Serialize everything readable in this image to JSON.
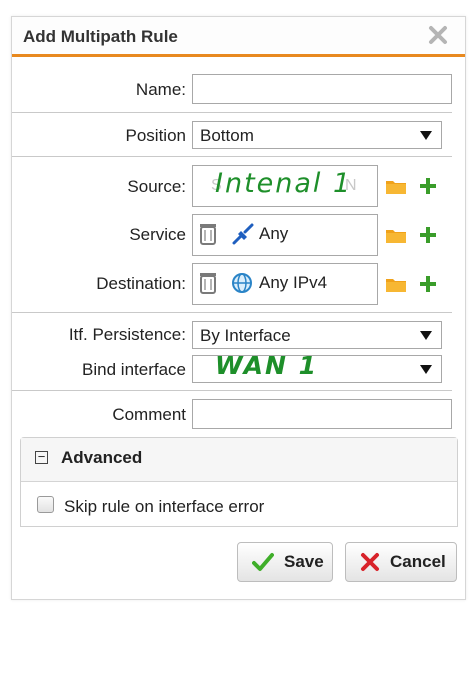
{
  "dialog": {
    "title": "Add Multipath Rule",
    "accent_color": "#e8891f"
  },
  "form": {
    "name_label": "Name:",
    "name_value": "",
    "position_label": "Position",
    "position_value": "Bottom",
    "source_label": "Source:",
    "source_faded_text": "S",
    "source_faded_tail": "N",
    "source_handwritten": "Intenal 1",
    "service_label": "Service",
    "service_value": "Any",
    "destination_label": "Destination:",
    "destination_value": "Any IPv4",
    "itf_persistence_label": "Itf. Persistence:",
    "itf_persistence_value": "By Interface",
    "bind_interface_label": "Bind interface",
    "bind_interface_handwritten": "WAN 1",
    "comment_label": "Comment",
    "comment_value": ""
  },
  "advanced": {
    "header": "Advanced",
    "toggle_symbol": "−",
    "skip_rule_label": "Skip rule on interface error",
    "skip_rule_checked": false
  },
  "buttons": {
    "save_label": "Save",
    "cancel_label": "Cancel"
  },
  "icons": {
    "close": "close-icon",
    "trash": "trash-icon",
    "service": "service-plug-icon",
    "globe": "globe-icon",
    "folder": "folder-icon",
    "add": "add-icon",
    "checkmark": "checkmark-icon",
    "cancel": "cross-icon"
  },
  "colors": {
    "folder": "#f0a21a",
    "add": "#3a9d2a",
    "save_check": "#3fae2a",
    "cancel_x": "#d8232a",
    "handwriting": "#1e8f2a"
  }
}
